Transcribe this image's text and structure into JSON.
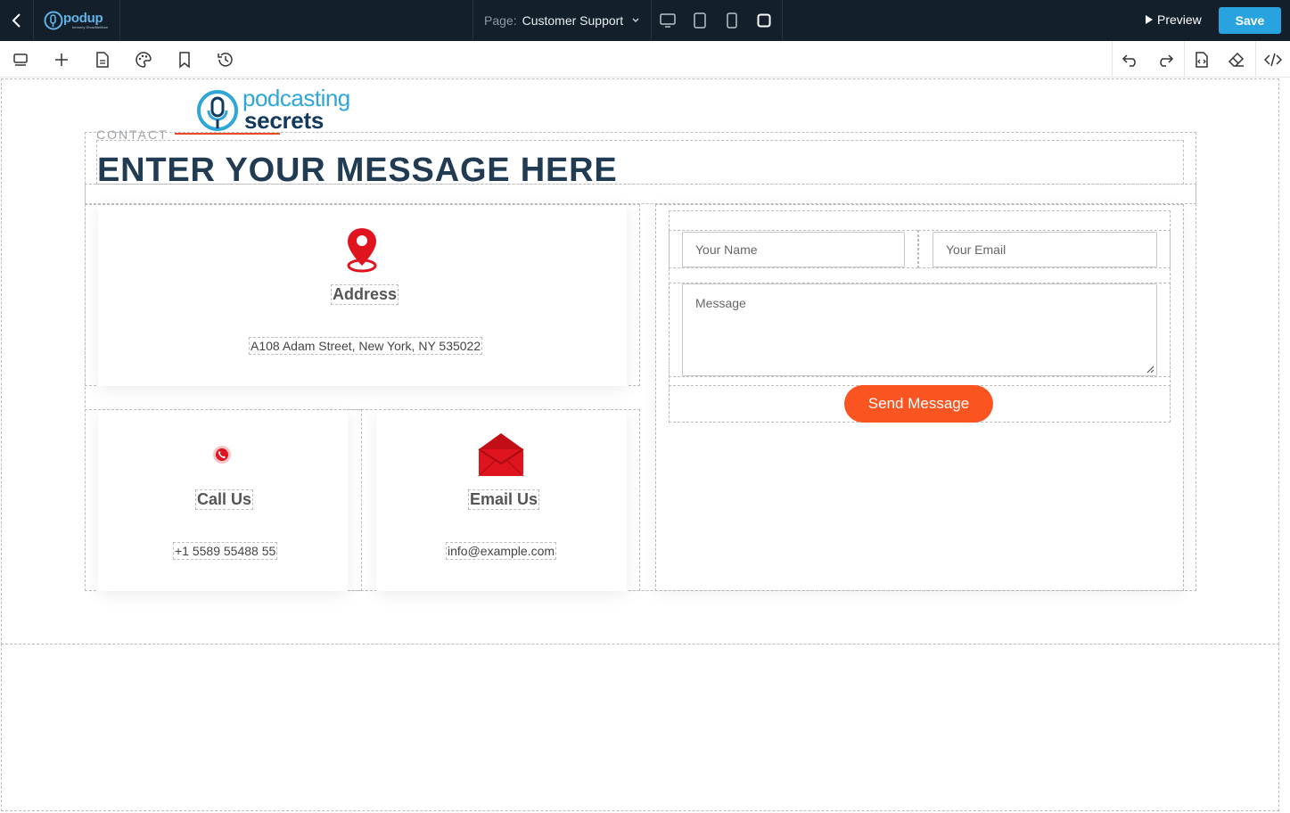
{
  "topbar": {
    "logo_main": "podup",
    "logo_sub": "formerly ShowMeMore",
    "page_label": "Page:",
    "page_value": "Customer Support",
    "preview_label": "Preview",
    "save_label": "Save"
  },
  "toolbar": {
    "icons": [
      "layers-icon",
      "add-icon",
      "page-icon",
      "palette-icon",
      "bookmark-icon",
      "history-icon",
      "undo-icon",
      "redo-icon",
      "code-file-icon",
      "eraser-icon",
      "code-icon"
    ]
  },
  "brand": {
    "line1": "podcasting",
    "line2": "secrets"
  },
  "section": {
    "eyebrow": "CONTACT",
    "heading": "ENTER YOUR MESSAGE HERE"
  },
  "cards": {
    "address": {
      "title": "Address",
      "text": "A108 Adam Street, New York, NY 535022"
    },
    "call": {
      "title": "Call Us",
      "text": "+1 5589 55488 55"
    },
    "email": {
      "title": "Email Us",
      "text": "info@example.com"
    }
  },
  "form": {
    "name_placeholder": "Your Name",
    "email_placeholder": "Your Email",
    "message_placeholder": "Message",
    "submit_label": "Send Message"
  },
  "colors": {
    "topbar_bg": "#13202b",
    "accent_blue": "#29a3e0",
    "heading": "#213b52",
    "send_button": "#fa5420",
    "icon_red": "#e0141e"
  }
}
